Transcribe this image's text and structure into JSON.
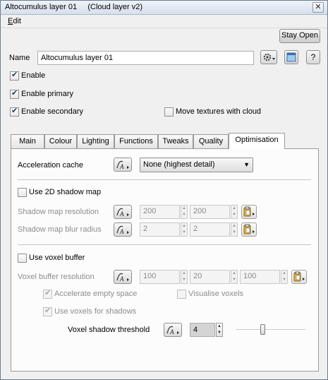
{
  "window": {
    "title": "Altocumulus layer 01     (Cloud layer v2)",
    "close": "✕"
  },
  "menu": {
    "edit": "Edit"
  },
  "buttons": {
    "stay_open": "Stay Open",
    "help": "?"
  },
  "name": {
    "label": "Name",
    "value": "Altocumulus layer 01"
  },
  "checks": {
    "enable": "Enable",
    "enable_primary": "Enable primary",
    "enable_secondary": "Enable secondary",
    "move_textures": "Move textures with cloud"
  },
  "tabs": [
    "Main",
    "Colour",
    "Lighting",
    "Functions",
    "Tweaks",
    "Quality",
    "Optimisation"
  ],
  "optimisation": {
    "acceleration_cache_label": "Acceleration cache",
    "acceleration_cache_value": "None (highest detail)",
    "use_2d_shadow_map": "Use 2D shadow map",
    "shadow_map_resolution_label": "Shadow map resolution",
    "shadow_map_resolution": [
      "200",
      "200"
    ],
    "shadow_map_blur_label": "Shadow map blur radius",
    "shadow_map_blur": [
      "2",
      "2"
    ],
    "use_voxel_buffer": "Use voxel buffer",
    "voxel_buffer_resolution_label": "Voxel buffer resolution",
    "voxel_buffer_resolution": [
      "100",
      "20",
      "100"
    ],
    "accelerate_empty_space": "Accelerate empty space",
    "visualise_voxels": "Visualise voxels",
    "use_voxels_for_shadows": "Use voxels for shadows",
    "voxel_shadow_threshold_label": "Voxel shadow threshold",
    "voxel_shadow_threshold": "4",
    "voxel_shadow_threshold_slider": 0.36
  }
}
